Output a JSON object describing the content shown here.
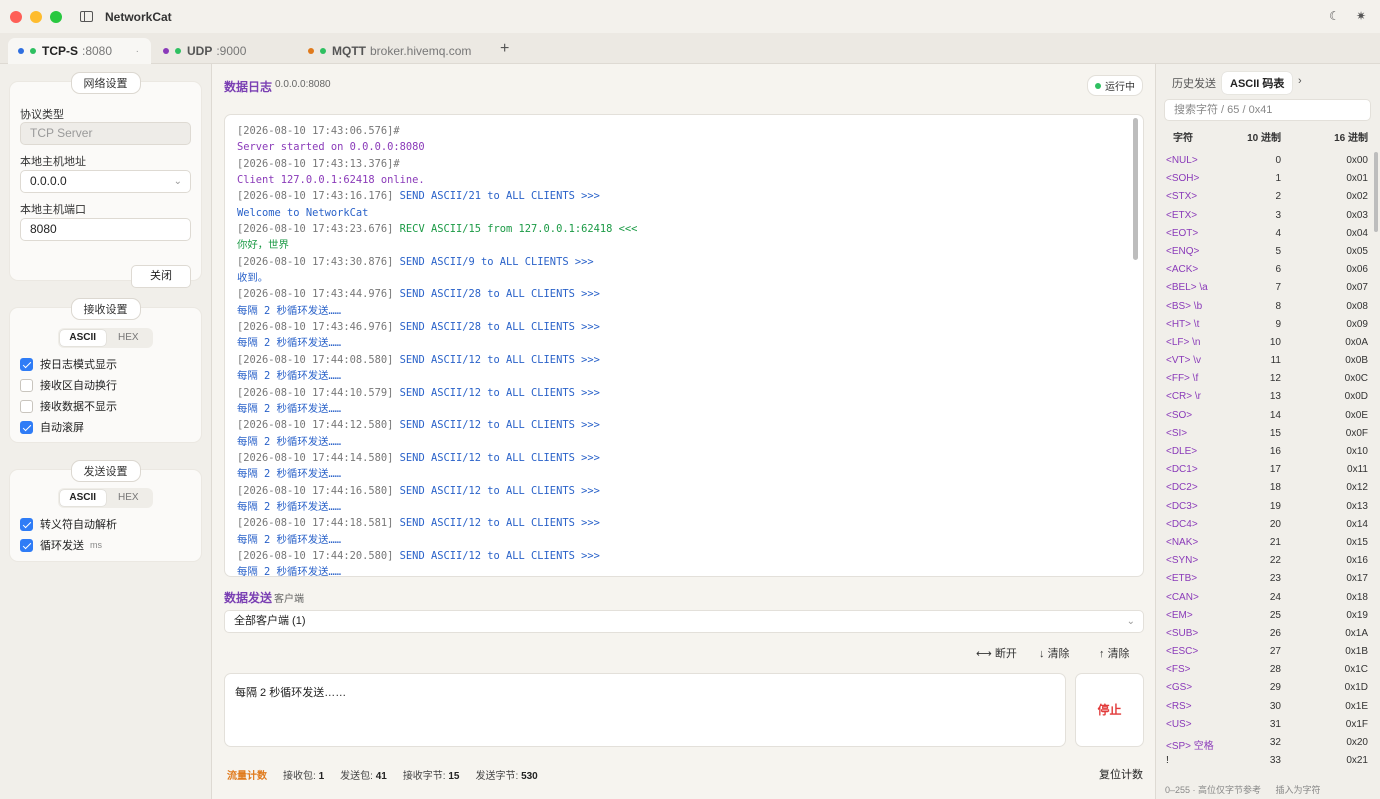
{
  "app": {
    "title": "NetworkCat",
    "theme_icon": "moon-icon",
    "settings_icon": "gear-icon"
  },
  "tabs": [
    {
      "proto": "TCP-S",
      "sub": ":8080",
      "dot_color": "#2f6fe0",
      "status_color": "#2ec061",
      "active": true,
      "close": "·"
    },
    {
      "proto": "UDP",
      "sub": ":9000",
      "dot_color": "#8a3ab9",
      "status_color": "#2ec061",
      "active": false
    },
    {
      "proto": "MQTT",
      "sub": "broker.hivemq.com",
      "dot_color": "#e07a1c",
      "status_color": "#2ec061",
      "active": false
    }
  ],
  "add_tab": "+",
  "network": {
    "title": "网络设置",
    "protocol_label": "协议类型",
    "protocol_value": "TCP Server",
    "host_label": "本地主机地址",
    "host_value": "0.0.0.0",
    "port_label": "本地主机端口",
    "port_value": "8080",
    "close_button": "关闭"
  },
  "receive": {
    "title": "接收设置",
    "mode_ascii": "ASCII",
    "mode_hex": "HEX",
    "options": [
      {
        "label": "按日志模式显示",
        "checked": true
      },
      {
        "label": "接收区自动换行",
        "checked": false
      },
      {
        "label": "接收数据不显示",
        "checked": false
      },
      {
        "label": "自动滚屏",
        "checked": true
      }
    ]
  },
  "send_settings": {
    "title": "发送设置",
    "mode_ascii": "ASCII",
    "mode_hex": "HEX",
    "options": [
      {
        "label": "转义符自动解析",
        "checked": true
      },
      {
        "label": "循环发送",
        "checked": true,
        "suffix": "ms"
      }
    ]
  },
  "log": {
    "title": "数据日志",
    "address": "0.0.0.0:8080",
    "status": "运行中",
    "lines": [
      {
        "ts": "[2026-08-10 17:43:06.576]#",
        "msg": "",
        "cls": ""
      },
      {
        "ts": "",
        "msg": "Server started on 0.0.0.0:8080",
        "cls": "c-purple"
      },
      {
        "ts": "[2026-08-10 17:43:13.376]#",
        "msg": "",
        "cls": ""
      },
      {
        "ts": "",
        "msg": "Client 127.0.0.1:62418 online.",
        "cls": "c-purple"
      },
      {
        "ts": "[2026-08-10 17:43:16.176]",
        "msg": "SEND ASCII/21 to ALL CLIENTS >>>",
        "cls": "c-blue"
      },
      {
        "ts": "",
        "msg": "Welcome to NetworkCat",
        "cls": "c-blue"
      },
      {
        "ts": "[2026-08-10 17:43:23.676]",
        "msg": "RECV ASCII/15 from 127.0.0.1:62418 <<<",
        "cls": "c-green"
      },
      {
        "ts": "",
        "msg": "你好，世界",
        "cls": "c-green"
      },
      {
        "ts": "[2026-08-10 17:43:30.876]",
        "msg": "SEND ASCII/9 to ALL CLIENTS >>>",
        "cls": "c-blue"
      },
      {
        "ts": "",
        "msg": "收到。",
        "cls": "c-blue"
      },
      {
        "ts": "[2026-08-10 17:43:44.976]",
        "msg": "SEND ASCII/28 to ALL CLIENTS >>>",
        "cls": "c-blue"
      },
      {
        "ts": "",
        "msg": "每隔 2 秒循环发送……",
        "cls": "c-blue"
      },
      {
        "ts": "[2026-08-10 17:43:46.976]",
        "msg": "SEND ASCII/28 to ALL CLIENTS >>>",
        "cls": "c-blue"
      },
      {
        "ts": "",
        "msg": "每隔 2 秒循环发送……",
        "cls": "c-blue"
      },
      {
        "ts": "[2026-08-10 17:44:08.580]",
        "msg": "SEND ASCII/12 to ALL CLIENTS >>>",
        "cls": "c-blue"
      },
      {
        "ts": "",
        "msg": "每隔 2 秒循环发送……",
        "cls": "c-blue"
      },
      {
        "ts": "[2026-08-10 17:44:10.579]",
        "msg": "SEND ASCII/12 to ALL CLIENTS >>>",
        "cls": "c-blue"
      },
      {
        "ts": "",
        "msg": "每隔 2 秒循环发送……",
        "cls": "c-blue"
      },
      {
        "ts": "[2026-08-10 17:44:12.580]",
        "msg": "SEND ASCII/12 to ALL CLIENTS >>>",
        "cls": "c-blue"
      },
      {
        "ts": "",
        "msg": "每隔 2 秒循环发送……",
        "cls": "c-blue"
      },
      {
        "ts": "[2026-08-10 17:44:14.580]",
        "msg": "SEND ASCII/12 to ALL CLIENTS >>>",
        "cls": "c-blue"
      },
      {
        "ts": "",
        "msg": "每隔 2 秒循环发送……",
        "cls": "c-blue"
      },
      {
        "ts": "[2026-08-10 17:44:16.580]",
        "msg": "SEND ASCII/12 to ALL CLIENTS >>>",
        "cls": "c-blue"
      },
      {
        "ts": "",
        "msg": "每隔 2 秒循环发送……",
        "cls": "c-blue"
      },
      {
        "ts": "[2026-08-10 17:44:18.581]",
        "msg": "SEND ASCII/12 to ALL CLIENTS >>>",
        "cls": "c-blue"
      },
      {
        "ts": "",
        "msg": "每隔 2 秒循环发送……",
        "cls": "c-blue"
      },
      {
        "ts": "[2026-08-10 17:44:20.580]",
        "msg": "SEND ASCII/12 to ALL CLIENTS >>>",
        "cls": "c-blue"
      },
      {
        "ts": "",
        "msg": "每隔 2 秒循环发送……",
        "cls": "c-blue"
      }
    ]
  },
  "send": {
    "title": "数据发送",
    "sub": "客户端",
    "target": "全部客户端 (1)",
    "disconnect": "断开",
    "clear_down": "清除",
    "clear_up": "清除",
    "content": "每隔 2 秒循环发送……",
    "stop_button": "停止"
  },
  "stats": {
    "label": "流量计数",
    "rx_packets_label": "接收包:",
    "rx_packets": "1",
    "tx_packets_label": "发送包:",
    "tx_packets": "41",
    "rx_bytes_label": "接收字节:",
    "rx_bytes": "15",
    "tx_bytes_label": "发送字节:",
    "tx_bytes": "530",
    "reset_button": "复位计数"
  },
  "right": {
    "tab_history": "历史发送",
    "tab_ascii": "ASCII 码表",
    "more": "›",
    "search_placeholder": "搜索字符 / 65 / 0x41",
    "col_char": "字符",
    "col_dec": "10 进制",
    "col_hex": "16 进制",
    "rows": [
      [
        "<NUL>",
        "0",
        "0x00"
      ],
      [
        "<SOH>",
        "1",
        "0x01"
      ],
      [
        "<STX>",
        "2",
        "0x02"
      ],
      [
        "<ETX>",
        "3",
        "0x03"
      ],
      [
        "<EOT>",
        "4",
        "0x04"
      ],
      [
        "<ENQ>",
        "5",
        "0x05"
      ],
      [
        "<ACK>",
        "6",
        "0x06"
      ],
      [
        "<BEL> \\a",
        "7",
        "0x07"
      ],
      [
        "<BS> \\b",
        "8",
        "0x08"
      ],
      [
        "<HT> \\t",
        "9",
        "0x09"
      ],
      [
        "<LF> \\n",
        "10",
        "0x0A"
      ],
      [
        "<VT> \\v",
        "11",
        "0x0B"
      ],
      [
        "<FF> \\f",
        "12",
        "0x0C"
      ],
      [
        "<CR> \\r",
        "13",
        "0x0D"
      ],
      [
        "<SO>",
        "14",
        "0x0E"
      ],
      [
        "<SI>",
        "15",
        "0x0F"
      ],
      [
        "<DLE>",
        "16",
        "0x10"
      ],
      [
        "<DC1>",
        "17",
        "0x11"
      ],
      [
        "<DC2>",
        "18",
        "0x12"
      ],
      [
        "<DC3>",
        "19",
        "0x13"
      ],
      [
        "<DC4>",
        "20",
        "0x14"
      ],
      [
        "<NAK>",
        "21",
        "0x15"
      ],
      [
        "<SYN>",
        "22",
        "0x16"
      ],
      [
        "<ETB>",
        "23",
        "0x17"
      ],
      [
        "<CAN>",
        "24",
        "0x18"
      ],
      [
        "<EM>",
        "25",
        "0x19"
      ],
      [
        "<SUB>",
        "26",
        "0x1A"
      ],
      [
        "<ESC>",
        "27",
        "0x1B"
      ],
      [
        "<FS>",
        "28",
        "0x1C"
      ],
      [
        "<GS>",
        "29",
        "0x1D"
      ],
      [
        "<RS>",
        "30",
        "0x1E"
      ],
      [
        "<US>",
        "31",
        "0x1F"
      ],
      [
        "<SP> 空格",
        "32",
        "0x20"
      ],
      [
        "!",
        "33",
        "0x21"
      ]
    ],
    "footer_range": "0–255 · 高位仅字节参考",
    "footer_insert": "插入为字符"
  }
}
